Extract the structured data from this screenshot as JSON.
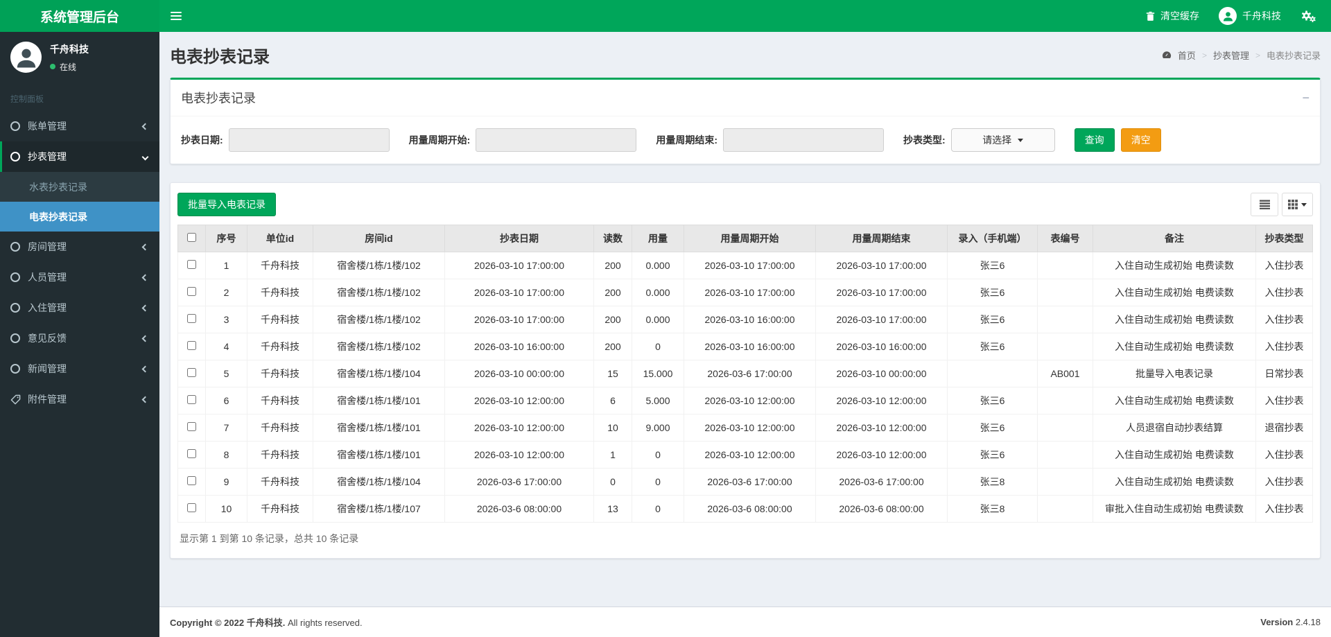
{
  "app": {
    "logo_title": "系统管理后台"
  },
  "navbar": {
    "clear_cache_label": "清空缓存",
    "user_name": "千舟科技"
  },
  "sidebar": {
    "user": {
      "name": "千舟科技",
      "status_label": "在线"
    },
    "section_label": "控制面板",
    "items": [
      {
        "label": "账单管理",
        "icon": "circle-icon"
      },
      {
        "label": "抄表管理",
        "icon": "circle-icon",
        "expanded": true,
        "children": [
          {
            "label": "水表抄表记录"
          },
          {
            "label": "电表抄表记录",
            "active": true
          }
        ]
      },
      {
        "label": "房间管理",
        "icon": "circle-icon"
      },
      {
        "label": "人员管理",
        "icon": "circle-icon"
      },
      {
        "label": "入住管理",
        "icon": "circle-icon"
      },
      {
        "label": "意见反馈",
        "icon": "circle-icon"
      },
      {
        "label": "新闻管理",
        "icon": "circle-icon"
      },
      {
        "label": "附件管理",
        "icon": "tag-icon"
      }
    ]
  },
  "content": {
    "page_title": "电表抄表记录",
    "breadcrumb": [
      "首页",
      "抄表管理",
      "电表抄表记录"
    ],
    "filter": {
      "box_title": "电表抄表记录",
      "fields": [
        {
          "label": "抄表日期:",
          "type": "input",
          "value": ""
        },
        {
          "label": "用量周期开始:",
          "type": "input",
          "value": ""
        },
        {
          "label": "用量周期结束:",
          "type": "input",
          "value": ""
        },
        {
          "label": "抄表类型:",
          "type": "select",
          "value": "请选择"
        }
      ],
      "search_label": "查询",
      "clear_label": "清空"
    },
    "toolbar": {
      "import_label": "批量导入电表记录"
    },
    "table": {
      "columns": [
        "序号",
        "单位id",
        "房间id",
        "抄表日期",
        "读数",
        "用量",
        "用量周期开始",
        "用量周期结束",
        "录入（手机端）",
        "表编号",
        "备注",
        "抄表类型"
      ],
      "rows": [
        [
          "1",
          "千舟科技",
          "宿舍楼/1栋/1楼/102",
          "2026-03-10 17:00:00",
          "200",
          "0.000",
          "2026-03-10 17:00:00",
          "2026-03-10 17:00:00",
          "张三6",
          "",
          "入住自动生成初始 电费读数",
          "入住抄表"
        ],
        [
          "2",
          "千舟科技",
          "宿舍楼/1栋/1楼/102",
          "2026-03-10 17:00:00",
          "200",
          "0.000",
          "2026-03-10 17:00:00",
          "2026-03-10 17:00:00",
          "张三6",
          "",
          "入住自动生成初始 电费读数",
          "入住抄表"
        ],
        [
          "3",
          "千舟科技",
          "宿舍楼/1栋/1楼/102",
          "2026-03-10 17:00:00",
          "200",
          "0.000",
          "2026-03-10 16:00:00",
          "2026-03-10 17:00:00",
          "张三6",
          "",
          "入住自动生成初始 电费读数",
          "入住抄表"
        ],
        [
          "4",
          "千舟科技",
          "宿舍楼/1栋/1楼/102",
          "2026-03-10 16:00:00",
          "200",
          "0",
          "2026-03-10 16:00:00",
          "2026-03-10 16:00:00",
          "张三6",
          "",
          "入住自动生成初始 电费读数",
          "入住抄表"
        ],
        [
          "5",
          "千舟科技",
          "宿舍楼/1栋/1楼/104",
          "2026-03-10 00:00:00",
          "15",
          "15.000",
          "2026-03-6 17:00:00",
          "2026-03-10 00:00:00",
          "",
          "AB001",
          "批量导入电表记录",
          "日常抄表"
        ],
        [
          "6",
          "千舟科技",
          "宿舍楼/1栋/1楼/101",
          "2026-03-10 12:00:00",
          "6",
          "5.000",
          "2026-03-10 12:00:00",
          "2026-03-10 12:00:00",
          "张三6",
          "",
          "入住自动生成初始 电费读数",
          "入住抄表"
        ],
        [
          "7",
          "千舟科技",
          "宿舍楼/1栋/1楼/101",
          "2026-03-10 12:00:00",
          "10",
          "9.000",
          "2026-03-10 12:00:00",
          "2026-03-10 12:00:00",
          "张三6",
          "",
          "人员退宿自动抄表结算",
          "退宿抄表"
        ],
        [
          "8",
          "千舟科技",
          "宿舍楼/1栋/1楼/101",
          "2026-03-10 12:00:00",
          "1",
          "0",
          "2026-03-10 12:00:00",
          "2026-03-10 12:00:00",
          "张三6",
          "",
          "入住自动生成初始 电费读数",
          "入住抄表"
        ],
        [
          "9",
          "千舟科技",
          "宿舍楼/1栋/1楼/104",
          "2026-03-6 17:00:00",
          "0",
          "0",
          "2026-03-6 17:00:00",
          "2026-03-6 17:00:00",
          "张三8",
          "",
          "入住自动生成初始 电费读数",
          "入住抄表"
        ],
        [
          "10",
          "千舟科技",
          "宿舍楼/1栋/1楼/107",
          "2026-03-6 08:00:00",
          "13",
          "0",
          "2026-03-6 08:00:00",
          "2026-03-6 08:00:00",
          "张三8",
          "",
          "审批入住自动生成初始 电费读数",
          "入住抄表"
        ]
      ]
    },
    "pagination_info": "显示第 1 到第 10 条记录，总共 10 条记录"
  },
  "footer": {
    "copyright_bold": "Copyright © 2022 千舟科技.",
    "copyright_rest": " All rights reserved.",
    "version_label": "Version",
    "version_value": "2.4.18"
  },
  "icons": {
    "trash-icon": "trash glyph",
    "cogs-icon": "double gear glyph",
    "user-icon": "person silhouette",
    "dashboard-icon": "speedometer glyph",
    "circle-icon": "outlined circle",
    "tag-icon": "label tag",
    "list-icon": "stacked bars",
    "columns-icon": "3x3 grid",
    "menu-icon": "hamburger bars"
  },
  "colors": {
    "brand_green": "#00a65a",
    "button_orange": "#f39c12",
    "sidebar_dark": "#222d32",
    "submenu_dark": "#2c3b41",
    "active_blue": "#3f92c6",
    "content_bg": "#ecf0f5"
  }
}
